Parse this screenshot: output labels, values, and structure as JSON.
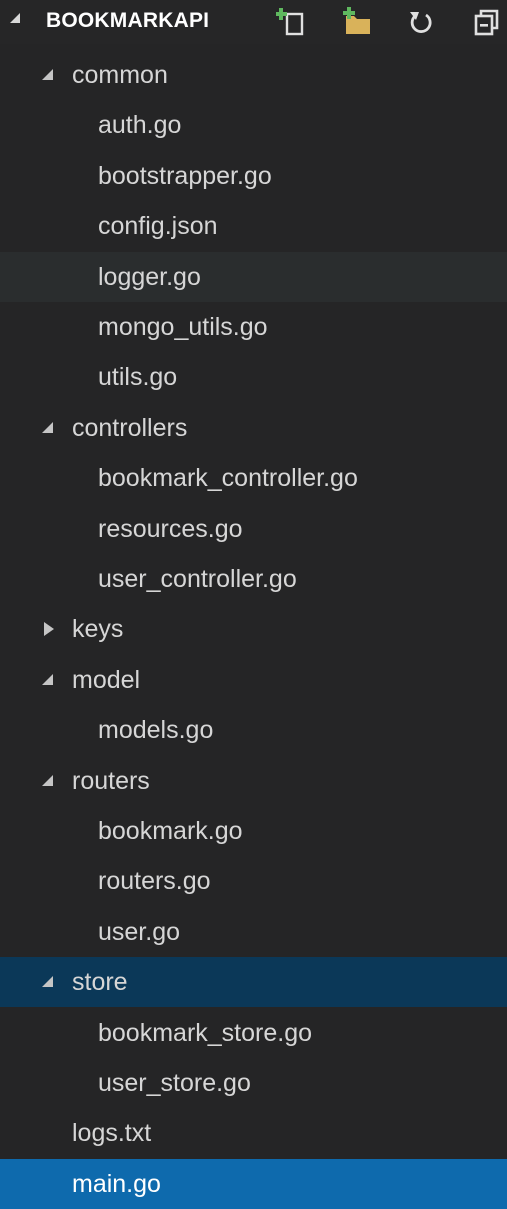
{
  "explorer": {
    "title": "BOOKMARKAPI",
    "actions": [
      {
        "name": "new-file-icon",
        "color": "#5fb85f"
      },
      {
        "name": "new-folder-icon",
        "color": "#d9b25a"
      },
      {
        "name": "refresh-icon"
      },
      {
        "name": "collapse-all-icon"
      }
    ],
    "rows": [
      {
        "kind": "folder",
        "label": "common",
        "expanded": true
      },
      {
        "kind": "file",
        "label": "auth.go"
      },
      {
        "kind": "file",
        "label": "bootstrapper.go"
      },
      {
        "kind": "file",
        "label": "config.json"
      },
      {
        "kind": "file",
        "label": "logger.go",
        "state": "hover"
      },
      {
        "kind": "file",
        "label": "mongo_utils.go"
      },
      {
        "kind": "file",
        "label": "utils.go"
      },
      {
        "kind": "folder",
        "label": "controllers",
        "expanded": true
      },
      {
        "kind": "file",
        "label": "bookmark_controller.go"
      },
      {
        "kind": "file",
        "label": "resources.go"
      },
      {
        "kind": "file",
        "label": "user_controller.go"
      },
      {
        "kind": "folder",
        "label": "keys",
        "expanded": false
      },
      {
        "kind": "folder",
        "label": "model",
        "expanded": true
      },
      {
        "kind": "file",
        "label": "models.go"
      },
      {
        "kind": "folder",
        "label": "routers",
        "expanded": true
      },
      {
        "kind": "file",
        "label": "bookmark.go"
      },
      {
        "kind": "file",
        "label": "routers.go"
      },
      {
        "kind": "file",
        "label": "user.go"
      },
      {
        "kind": "folder",
        "label": "store",
        "expanded": true,
        "state": "selected-dim"
      },
      {
        "kind": "file",
        "label": "bookmark_store.go"
      },
      {
        "kind": "file",
        "label": "user_store.go"
      },
      {
        "kind": "root-file",
        "label": "logs.txt"
      },
      {
        "kind": "root-file",
        "label": "main.go",
        "state": "selected"
      }
    ]
  },
  "colors": {
    "background": "#252526",
    "hover": "#2a2d2e",
    "selected_inactive": "#0b3858",
    "selected_active": "#0e6aad"
  }
}
